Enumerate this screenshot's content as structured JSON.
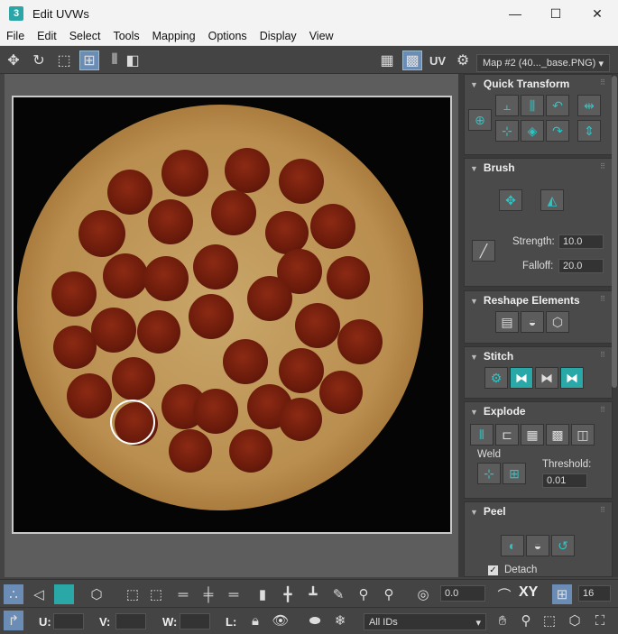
{
  "window": {
    "app_icon_text": "3",
    "title": "Edit UVWs",
    "minimize": "—",
    "maximize": "☐",
    "close": "✕"
  },
  "menu": [
    "File",
    "Edit",
    "Select",
    "Tools",
    "Mapping",
    "Options",
    "Display",
    "View"
  ],
  "toolbar": {
    "uv_label": "UV",
    "map_dropdown": "Map #2 (40..._base.PNG)",
    "dropdown_arrow": "▾"
  },
  "panel": {
    "quick_transform": {
      "title": "Quick Transform"
    },
    "brush": {
      "title": "Brush",
      "strength_label": "Strength:",
      "strength_value": "10.0",
      "falloff_label": "Falloff:",
      "falloff_value": "20.0"
    },
    "reshape": {
      "title": "Reshape Elements"
    },
    "stitch": {
      "title": "Stitch"
    },
    "explode": {
      "title": "Explode",
      "weld_label": "Weld",
      "threshold_label": "Threshold:",
      "threshold_value": "0.01"
    },
    "peel": {
      "title": "Peel",
      "detach_label": "Detach",
      "detach_checked": true
    }
  },
  "bottom": {
    "spin_value": "0.0",
    "xy_label": "XY",
    "num_value": "16",
    "u_label": "U:",
    "v_label": "V:",
    "w_label": "W:",
    "l_label": "L:",
    "ids_dropdown": "All IDs"
  },
  "colors": {
    "accent": "#2aa7a7",
    "panel_bg": "#3a3a3a",
    "viewport_bg": "#050505"
  }
}
